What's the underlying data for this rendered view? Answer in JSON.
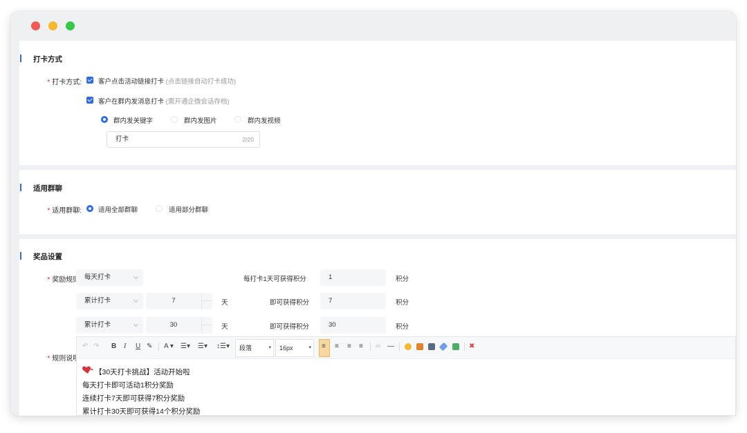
{
  "checkin": {
    "section_title": "打卡方式",
    "method_label": "打卡方式:",
    "opt_click": "客户点击活动链接打卡",
    "opt_click_hint": "(点击链接自动打卡成功)",
    "opt_group": "客户在群内发消息打卡",
    "opt_group_hint": "(需开通企微会话存档)",
    "radios": [
      "群内发关键字",
      "群内发图片",
      "群内发视频"
    ],
    "keyword_value": "打卡",
    "keyword_counter": "2/20"
  },
  "group": {
    "section_title": "适用群聊",
    "label": "适用群聊:",
    "options": [
      "适用全部群聊",
      "适用部分群聊"
    ]
  },
  "reward": {
    "section_title": "奖品设置",
    "rule_label": "奖励规则:",
    "rows": [
      {
        "type": "每天打卡",
        "prefix": "每打卡1天可获得积分",
        "points": "1",
        "suffix": "积分"
      },
      {
        "type": "累计打卡",
        "days": "7",
        "unit": "天",
        "prefix": "即可获得积分",
        "points": "7",
        "suffix": "积分"
      },
      {
        "type": "累计打卡",
        "days": "30",
        "unit": "天",
        "prefix": "即可获得积分",
        "points": "30",
        "suffix": "积分"
      }
    ],
    "desc_label": "规则说明:"
  },
  "editor": {
    "toolbar": {
      "bold": "B",
      "italic": "I",
      "underline": "U",
      "font_color": "A",
      "paragraph": "段落",
      "font_size": "16px"
    },
    "lines": [
      "【30天打卡挑战】活动开始啦",
      "每天打卡即可活动1积分奖励",
      "连续打卡7天即可获得7积分奖励",
      "累计打卡30天即可获得14个积分奖励"
    ]
  },
  "colors": {
    "accent": "#2f6be6",
    "required": "#f5222d"
  }
}
